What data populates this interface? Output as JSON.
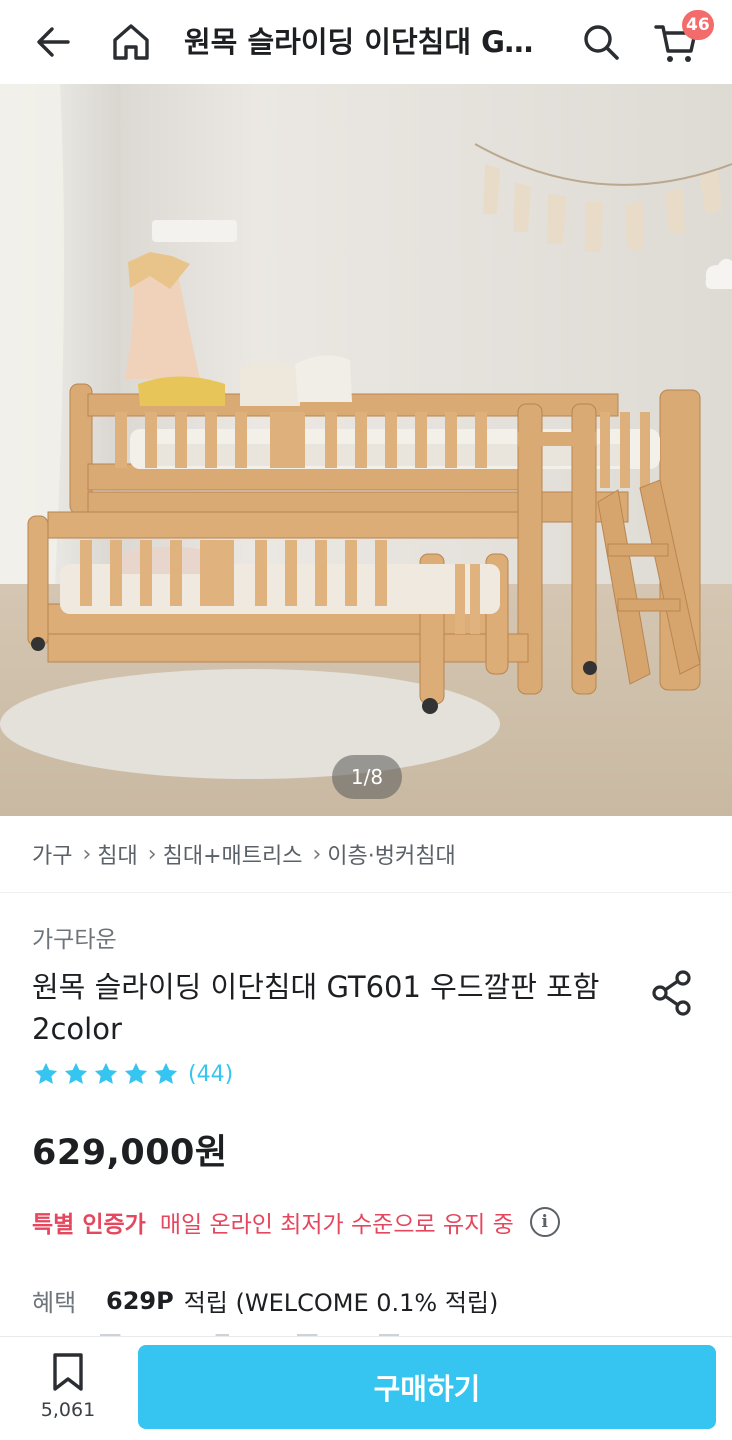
{
  "header": {
    "title": "원목 슬라이딩 이단침대 GT601 우드깔판 포함 2color",
    "cart_count": "46",
    "icons": [
      "back-arrow-icon",
      "home-icon",
      "search-icon",
      "cart-icon"
    ]
  },
  "gallery": {
    "counter": "1/8"
  },
  "breadcrumb": {
    "items": [
      "가구",
      "침대",
      "침대+매트리스",
      "이층·벙커침대"
    ]
  },
  "product": {
    "brand": "가구타운",
    "title": "원목 슬라이딩 이단침대 GT601 우드깔판 포함 2color",
    "rating_stars": 5,
    "review_count": "(44)",
    "price": "629,000원",
    "special_label": "특별 인증가",
    "special_desc": "매일 온라인 최저가 수준으로 유지 중",
    "benefit_label": "혜택",
    "benefit_point": "629P",
    "benefit_desc": "적립 (WELCOME 0.1% 적립)"
  },
  "bottom_bar": {
    "bookmark_count": "5,061",
    "buy_label": "구매하기"
  },
  "colors": {
    "accent": "#35c5f0",
    "special": "#e5475e",
    "badge": "#f36b6b"
  }
}
